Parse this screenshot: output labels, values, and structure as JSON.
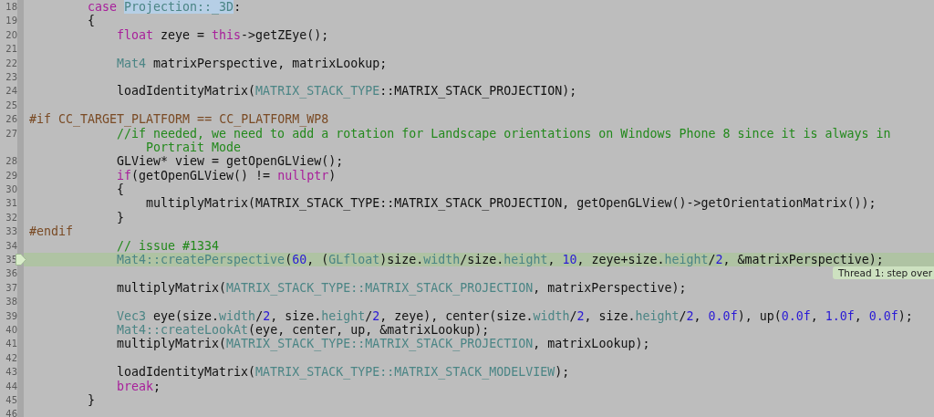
{
  "editor": {
    "lines": [
      {
        "number": "18",
        "kind": "outer",
        "current": false,
        "tokens": [
          {
            "kind": "keyword",
            "text": "case"
          },
          {
            "kind": "selected",
            "text": "Projection::_3D"
          },
          {
            "kind": "plain",
            "text": ":"
          }
        ]
      },
      {
        "number": "19",
        "kind": "outer",
        "current": false,
        "tokens": [
          {
            "kind": "plain",
            "text": "{"
          }
        ]
      },
      {
        "number": "20",
        "kind": "statement",
        "current": false,
        "tokens": [
          {
            "kind": "keyword",
            "text": "float"
          },
          {
            "kind": "plain",
            "text": " zeye = "
          },
          {
            "kind": "keyword",
            "text": "this"
          },
          {
            "kind": "plain",
            "text": "->getZEye();"
          }
        ]
      },
      {
        "number": "21",
        "current": false
      },
      {
        "number": "22",
        "kind": "statement",
        "current": false,
        "tokens": [
          {
            "kind": "type",
            "text": "Mat4"
          },
          {
            "kind": "plain",
            "text": " matrixPerspective, matrixLookup;"
          }
        ]
      },
      {
        "number": "23",
        "current": false
      },
      {
        "number": "24",
        "kind": "statement",
        "current": false,
        "tokens": [
          {
            "kind": "plain",
            "text": "loadIdentityMatrix("
          },
          {
            "kind": "type",
            "text": "MATRIX_STACK_TYPE"
          },
          {
            "kind": "plain",
            "text": "::MATRIX_STACK_PROJECTION);"
          }
        ]
      },
      {
        "number": "25",
        "current": false
      },
      {
        "number": "26",
        "kind": "directive",
        "current": false,
        "tokens": [
          {
            "kind": "preprocessor",
            "text": "#if CC_TARGET_PLATFORM == CC_PLATFORM_WP8"
          }
        ]
      },
      {
        "number": "27",
        "kind": "statement",
        "current": false,
        "tokens": [
          {
            "kind": "comment",
            "text": "//if needed, we need to add a rotation for Landscape orientations on Windows Phone 8 since it is always in"
          }
        ],
        "continuation": {
          "kind": "nested",
          "tokens": [
            {
              "kind": "comment",
              "text": "Portrait Mode"
            }
          ]
        }
      },
      {
        "number": "28",
        "kind": "statement",
        "current": false,
        "tokens": [
          {
            "kind": "plain",
            "text": "GLView* view = getOpenGLView();"
          }
        ]
      },
      {
        "number": "29",
        "kind": "statement",
        "current": false,
        "tokens": [
          {
            "kind": "keyword",
            "text": "if"
          },
          {
            "kind": "plain",
            "text": "(getOpenGLView() != "
          },
          {
            "kind": "keyword",
            "text": "nullptr"
          },
          {
            "kind": "plain",
            "text": ")"
          }
        ]
      },
      {
        "number": "30",
        "kind": "statement",
        "current": false,
        "tokens": [
          {
            "kind": "plain",
            "text": "{"
          }
        ]
      },
      {
        "number": "31",
        "kind": "nested",
        "current": false,
        "tokens": [
          {
            "kind": "plain",
            "text": "multiplyMatrix(MATRIX_STACK_TYPE::MATRIX_STACK_PROJECTION, getOpenGLView()->getOrientationMatrix());"
          }
        ]
      },
      {
        "number": "32",
        "kind": "statement",
        "current": false,
        "tokens": [
          {
            "kind": "plain",
            "text": "}"
          }
        ]
      },
      {
        "number": "33",
        "kind": "directive",
        "current": false,
        "tokens": [
          {
            "kind": "preprocessor",
            "text": "#endif"
          }
        ]
      },
      {
        "number": "34",
        "kind": "statement",
        "current": false,
        "tokens": [
          {
            "kind": "comment",
            "text": "// issue #1334"
          }
        ]
      },
      {
        "number": "35",
        "kind": "statement",
        "current": true,
        "annotation": "Thread 1: step over",
        "tokens": [
          {
            "kind": "type",
            "text": "Mat4::createPerspective"
          },
          {
            "kind": "plain",
            "text": "("
          },
          {
            "kind": "number",
            "text": "60"
          },
          {
            "kind": "plain",
            "text": ", ("
          },
          {
            "kind": "type",
            "text": "GLfloat"
          },
          {
            "kind": "plain",
            "text": ")size."
          },
          {
            "kind": "type",
            "text": "width"
          },
          {
            "kind": "plain",
            "text": "/size."
          },
          {
            "kind": "type",
            "text": "height"
          },
          {
            "kind": "plain",
            "text": ", "
          },
          {
            "kind": "number",
            "text": "10"
          },
          {
            "kind": "plain",
            "text": ", zeye+size."
          },
          {
            "kind": "type",
            "text": "height"
          },
          {
            "kind": "plain",
            "text": "/"
          },
          {
            "kind": "number",
            "text": "2"
          },
          {
            "kind": "plain",
            "text": ", &matrixPerspective);"
          }
        ]
      },
      {
        "number": "36",
        "current": false
      },
      {
        "number": "37",
        "kind": "statement",
        "current": false,
        "tokens": [
          {
            "kind": "plain",
            "text": "multiplyMatrix("
          },
          {
            "kind": "type",
            "text": "MATRIX_STACK_TYPE::MATRIX_STACK_PROJECTION"
          },
          {
            "kind": "plain",
            "text": ", matrixPerspective);"
          }
        ]
      },
      {
        "number": "38",
        "current": false
      },
      {
        "number": "39",
        "kind": "statement",
        "current": false,
        "tokens": [
          {
            "kind": "type",
            "text": "Vec3"
          },
          {
            "kind": "plain",
            "text": " eye(size."
          },
          {
            "kind": "type",
            "text": "width"
          },
          {
            "kind": "plain",
            "text": "/"
          },
          {
            "kind": "number",
            "text": "2"
          },
          {
            "kind": "plain",
            "text": ", size."
          },
          {
            "kind": "type",
            "text": "height"
          },
          {
            "kind": "plain",
            "text": "/"
          },
          {
            "kind": "number",
            "text": "2"
          },
          {
            "kind": "plain",
            "text": ", zeye), center(size."
          },
          {
            "kind": "type",
            "text": "width"
          },
          {
            "kind": "plain",
            "text": "/"
          },
          {
            "kind": "number",
            "text": "2"
          },
          {
            "kind": "plain",
            "text": ", size."
          },
          {
            "kind": "type",
            "text": "height"
          },
          {
            "kind": "plain",
            "text": "/"
          },
          {
            "kind": "number",
            "text": "2"
          },
          {
            "kind": "plain",
            "text": ", "
          },
          {
            "kind": "number",
            "text": "0.0f"
          },
          {
            "kind": "plain",
            "text": "), up("
          },
          {
            "kind": "number",
            "text": "0.0f"
          },
          {
            "kind": "plain",
            "text": ", "
          },
          {
            "kind": "number",
            "text": "1.0f"
          },
          {
            "kind": "plain",
            "text": ", "
          },
          {
            "kind": "number",
            "text": "0.0f"
          },
          {
            "kind": "plain",
            "text": ");"
          }
        ]
      },
      {
        "number": "40",
        "kind": "statement",
        "current": false,
        "tokens": [
          {
            "kind": "type",
            "text": "Mat4::createLookAt"
          },
          {
            "kind": "plain",
            "text": "(eye, center, up, &matrixLookup);"
          }
        ]
      },
      {
        "number": "41",
        "kind": "statement",
        "current": false,
        "tokens": [
          {
            "kind": "plain",
            "text": "multiplyMatrix("
          },
          {
            "kind": "type",
            "text": "MATRIX_STACK_TYPE::MATRIX_STACK_PROJECTION"
          },
          {
            "kind": "plain",
            "text": ", matrixLookup);"
          }
        ]
      },
      {
        "number": "42",
        "current": false
      },
      {
        "number": "43",
        "kind": "statement",
        "current": false,
        "tokens": [
          {
            "kind": "plain",
            "text": "loadIdentityMatrix("
          },
          {
            "kind": "type",
            "text": "MATRIX_STACK_TYPE::MATRIX_STACK_MODELVIEW"
          },
          {
            "kind": "plain",
            "text": ");"
          }
        ]
      },
      {
        "number": "44",
        "kind": "statement",
        "current": false,
        "tokens": [
          {
            "kind": "keyword",
            "text": "break"
          },
          {
            "kind": "plain",
            "text": ";"
          }
        ]
      },
      {
        "number": "45",
        "kind": "outer",
        "current": false,
        "tokens": [
          {
            "kind": "plain",
            "text": "}"
          }
        ]
      },
      {
        "number": "46",
        "current": false
      }
    ]
  }
}
